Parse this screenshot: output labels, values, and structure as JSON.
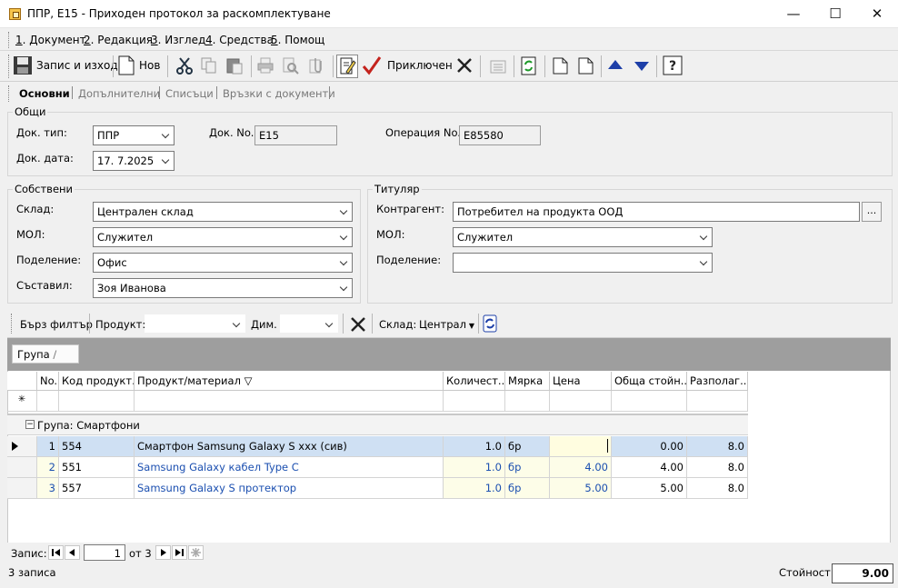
{
  "window": {
    "title": "ППР, E15 - Приходен протокол за раскомплектуване",
    "minimize": "—",
    "maximize": "☐",
    "close": "✕"
  },
  "menu": [
    {
      "key": "1",
      "label": ". Документ"
    },
    {
      "key": "2",
      "label": ". Редакция"
    },
    {
      "key": "3",
      "label": ". Изглед"
    },
    {
      "key": "4",
      "label": ". Средства"
    },
    {
      "key": "5",
      "label": ". Помощ"
    }
  ],
  "toolbar": {
    "save_exit": "Запис и изход",
    "new": "Нов",
    "finished": "Приключен"
  },
  "tabs": [
    "Основни",
    "Допълнителни",
    "Списъци",
    "Връзки с документи"
  ],
  "general": {
    "title": "Общи",
    "doc_type_label": "Док. тип:",
    "doc_type": "ППР",
    "doc_no_label": "Док. No.",
    "doc_no": "E15",
    "op_no_label": "Операция No.",
    "op_no": "E85580",
    "doc_date_label": "Док. дата:",
    "doc_date": "17.  7.2025"
  },
  "own": {
    "title": "Собствени",
    "store_label": "Склад:",
    "store": "Централен склад",
    "mol_label": "МОЛ:",
    "mol": "Служител",
    "division_label": "Поделение:",
    "division": "Офис",
    "author_label": "Съставил:",
    "author": "Зоя Иванова"
  },
  "holder": {
    "title": "Титуляр",
    "partner_label": "Контрагент:",
    "partner": "Потребител на продукта ООД",
    "mol_label": "МОЛ:",
    "mol": "Служител",
    "division_label": "Поделение:",
    "division": "",
    "browse": "..."
  },
  "filter": {
    "quick": "Бърз филтър",
    "product_label": "Продукт:",
    "product": "",
    "dim_label": "Дим.",
    "dim": "",
    "store_label": "Склад:",
    "store": "Централ"
  },
  "grouping": {
    "chip": "Група",
    "sort_mark": "/"
  },
  "grid": {
    "headers": [
      "No.",
      "Код продукт...",
      "Продукт/материал ▽",
      "Количест...",
      "Мярка",
      "Цена",
      "Обща стойн...",
      "Разполаг..."
    ],
    "new_row_marker": "✳",
    "group_label": "Група: Смартфони",
    "group_toggle": "−",
    "rows": [
      {
        "no": "1",
        "code": "554",
        "name": "Смартфон Samsung Galaxy S  xxx (сив)",
        "qty": "1.0",
        "unit": "бр",
        "price": "",
        "total": "0.00",
        "avail": "8.0"
      },
      {
        "no": "2",
        "code": "551",
        "name": "Samsung Galaxy кабел Type C",
        "qty": "1.0",
        "unit": "бр",
        "price": "4.00",
        "total": "4.00",
        "avail": "8.0"
      },
      {
        "no": "3",
        "code": "557",
        "name": "Samsung Galaxy S протектор",
        "qty": "1.0",
        "unit": "бр",
        "price": "5.00",
        "total": "5.00",
        "avail": "8.0"
      }
    ]
  },
  "nav": {
    "label": "Запис:",
    "current": "1",
    "of": "от 3"
  },
  "status": {
    "records": "3 записа",
    "value_label": "Стойност:",
    "value": "9.00"
  }
}
